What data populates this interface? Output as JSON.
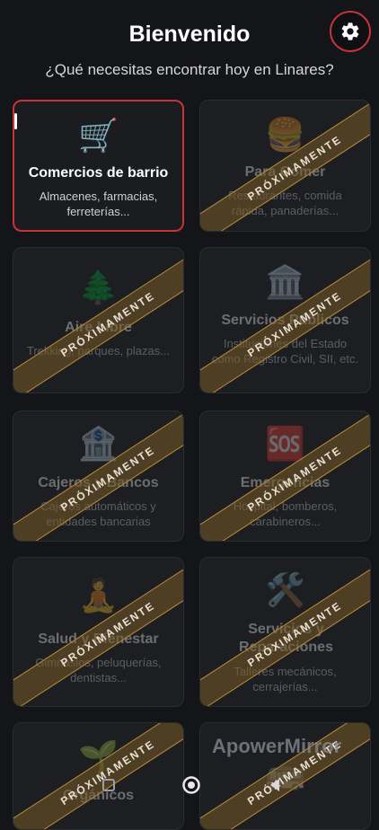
{
  "header": {
    "title": "Bienvenido",
    "subtitle": "¿Qué necesitas encontrar hoy en Linares?",
    "settings_icon": "gear-icon"
  },
  "ribbon_label": "PRÓXIMAMENTE",
  "categories": [
    {
      "emoji": "🛒",
      "icon": "shopping-cart-icon",
      "name": "Comercios de barrio",
      "desc": "Almacenes, farmacias, ferreterías...",
      "status": "available"
    },
    {
      "emoji": "🍔",
      "icon": "burger-icon",
      "name": "Para Comer",
      "desc": "Restaurantes, comida rápida, panaderías...",
      "status": "coming_soon"
    },
    {
      "emoji": "🌲",
      "icon": "tree-icon",
      "name": "Aire Libre",
      "desc": "Trekking, parques, plazas...",
      "status": "coming_soon"
    },
    {
      "emoji": "🏛️",
      "icon": "government-building-icon",
      "name": "Servicios Públicos",
      "desc": "Instituciones del Estado como Registro Civil, SII, etc.",
      "status": "coming_soon"
    },
    {
      "emoji": "🏦",
      "icon": "bank-icon",
      "name": "Cajeros y Bancos",
      "desc": "Cajeros automáticos y entidades bancarias",
      "status": "coming_soon"
    },
    {
      "emoji": "🆘",
      "icon": "sos-icon",
      "name": "Emergencias",
      "desc": "Hospital, bomberos, carabineros...",
      "status": "coming_soon"
    },
    {
      "emoji": "🧘",
      "icon": "meditation-icon",
      "name": "Salud y Bienestar",
      "desc": "Gimnasios, peluquerías, dentistas...",
      "status": "coming_soon"
    },
    {
      "emoji": "🛠️",
      "icon": "tools-icon",
      "name": "Servicios y Reparaciones",
      "desc": "Talleres mecánicos, cerrajerías...",
      "status": "coming_soon"
    },
    {
      "emoji": "🌱",
      "icon": "seedling-icon",
      "name": "Orgánicos",
      "desc": "",
      "status": "coming_soon"
    },
    {
      "emoji": "🚌",
      "icon": "bus-icon",
      "name": "",
      "desc": "",
      "status": "coming_soon"
    }
  ],
  "watermark": "ApowerMirror",
  "colors": {
    "background": "#141518",
    "card": "#1c1e22",
    "accent": "#c8333a",
    "ribbon": "#b48a3a"
  }
}
